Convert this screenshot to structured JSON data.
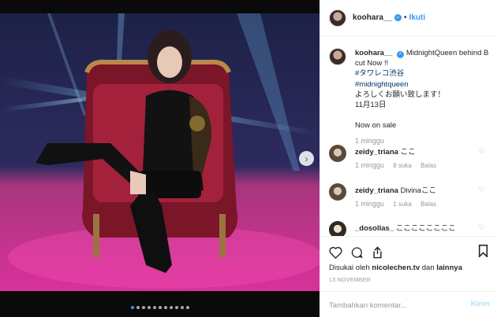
{
  "post": {
    "username": "koohara__",
    "separator": "•",
    "follow_label": "Ikuti"
  },
  "caption": {
    "username": "koohara__",
    "lines": [
      "MidnightQueen behind B",
      "cut Now !!",
      "#タワレコ渋谷",
      "#midnightqueen",
      "よろしくお願い致します！",
      "11月13日",
      "",
      "Now on sale"
    ],
    "time": "1 minggu"
  },
  "comments": [
    {
      "username": "zeidy_triana",
      "text": "ここ",
      "time": "1 minggu",
      "likes": "",
      "reply": ""
    },
    {
      "username": "zeidy_triana",
      "text": "Divinaここ",
      "time": "1 minggu",
      "likes": "8 suka",
      "reply": "Balas"
    },
    {
      "username": "",
      "text": "",
      "time": "1 minggu",
      "likes": "1 suka",
      "reply": "Balas"
    },
    {
      "username": "_dosollas_",
      "text": "ここここここここ",
      "time": "",
      "likes": "",
      "reply": ""
    }
  ],
  "likes": {
    "prefix": "Disukai oleh",
    "user": "nicolechen.tv",
    "joiner": "dan",
    "rest": "lainnya"
  },
  "date": "13 NOVEMBER",
  "add_comment": {
    "placeholder": "Tambahkan komentar...",
    "post_label": "Kirim"
  },
  "carousel": {
    "dot_count": 11,
    "active_index": 0
  },
  "icons": [
    "chevron-right-icon",
    "heart-icon",
    "comment-icon",
    "share-icon",
    "bookmark-icon",
    "verified-icon"
  ],
  "colors": {
    "link": "#3897f0",
    "hashtag": "#003569",
    "muted": "#999999"
  }
}
